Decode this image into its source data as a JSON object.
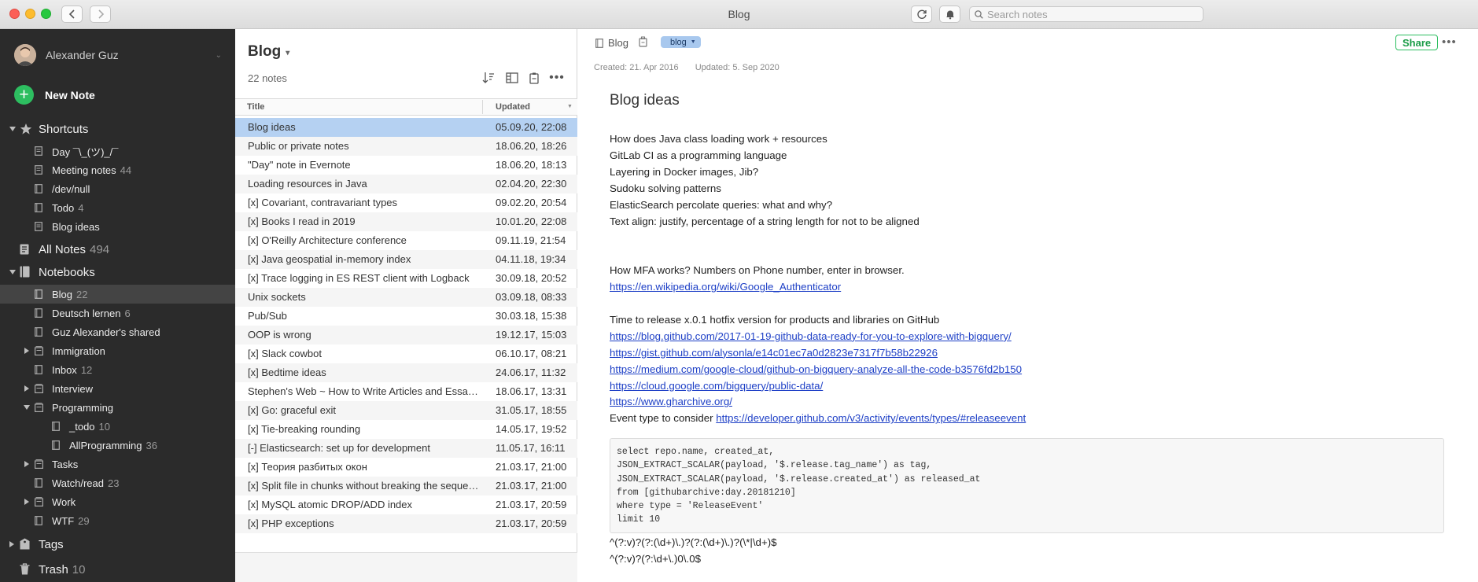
{
  "window": {
    "title": "Blog"
  },
  "toolbar": {
    "search_placeholder": "Search notes"
  },
  "sidebar": {
    "user_name": "Alexander Guz",
    "new_note_label": "New Note",
    "shortcuts_label": "Shortcuts",
    "shortcuts": [
      {
        "label": "Day ¯\\_(ツ)_/¯",
        "count": ""
      },
      {
        "label": "Meeting notes",
        "count": "44"
      },
      {
        "label": "/dev/null",
        "count": ""
      },
      {
        "label": "Todo",
        "count": "4"
      },
      {
        "label": "Blog ideas",
        "count": ""
      }
    ],
    "all_notes_label": "All Notes",
    "all_notes_count": "494",
    "notebooks_label": "Notebooks",
    "notebooks": [
      {
        "label": "Blog",
        "count": "22"
      },
      {
        "label": "Deutsch lernen",
        "count": "6"
      },
      {
        "label": "Guz Alexander's shared",
        "count": ""
      },
      {
        "label": "Immigration",
        "count": ""
      },
      {
        "label": "Inbox",
        "count": "12"
      },
      {
        "label": "Interview",
        "count": ""
      },
      {
        "label": "Programming",
        "count": ""
      },
      {
        "label": "_todo",
        "count": "10"
      },
      {
        "label": "AllProgramming",
        "count": "36"
      },
      {
        "label": "Tasks",
        "count": ""
      },
      {
        "label": "Watch/read",
        "count": "23"
      },
      {
        "label": "Work",
        "count": ""
      },
      {
        "label": "WTF",
        "count": "29"
      }
    ],
    "tags_label": "Tags",
    "trash_label": "Trash",
    "trash_count": "10"
  },
  "notelist": {
    "title": "Blog",
    "count_label": "22 notes",
    "col_title": "Title",
    "col_updated": "Updated",
    "rows": [
      {
        "title": "Blog ideas",
        "date": "05.09.20, 22:08"
      },
      {
        "title": "Public or private notes",
        "date": "18.06.20, 18:26"
      },
      {
        "title": "\"Day\" note in Evernote",
        "date": "18.06.20, 18:13"
      },
      {
        "title": "Loading resources in Java",
        "date": "02.04.20, 22:30"
      },
      {
        "title": "[x] Covariant, contravariant types",
        "date": "09.02.20, 20:54"
      },
      {
        "title": "[x] Books I read in 2019",
        "date": "10.01.20, 22:08"
      },
      {
        "title": "[x] O'Reilly Architecture conference",
        "date": "09.11.19, 21:54"
      },
      {
        "title": "[x] Java geospatial in-memory index",
        "date": "04.11.18, 19:34"
      },
      {
        "title": "[x] Trace logging in ES REST client with Logback",
        "date": "30.09.18, 20:52"
      },
      {
        "title": "Unix sockets",
        "date": "03.09.18, 08:33"
      },
      {
        "title": "Pub/Sub",
        "date": "30.03.18, 15:38"
      },
      {
        "title": "OOP is wrong",
        "date": "19.12.17, 15:03"
      },
      {
        "title": "[x] Slack cowbot",
        "date": "06.10.17, 08:21"
      },
      {
        "title": "[x] Bedtime ideas",
        "date": "24.06.17, 11:32"
      },
      {
        "title": "Stephen's Web ~ How to Write Articles and Essays Quickly and Expertly",
        "date": "18.06.17, 13:31"
      },
      {
        "title": "[x] Go: graceful exit",
        "date": "31.05.17, 18:55"
      },
      {
        "title": "[x] Tie-breaking rounding",
        "date": "14.05.17, 19:52"
      },
      {
        "title": "[-] Elasticsearch: set up for development",
        "date": "11.05.17, 16:11"
      },
      {
        "title": "[x] Теория разбитых окон",
        "date": "21.03.17, 21:00"
      },
      {
        "title": "[x] Split file in chunks without breaking the sequence",
        "date": "21.03.17, 21:00"
      },
      {
        "title": "[x] MySQL atomic DROP/ADD index",
        "date": "21.03.17, 20:59"
      },
      {
        "title": "[x] PHP exceptions",
        "date": "21.03.17, 20:59"
      }
    ]
  },
  "editor": {
    "notebook": "Blog",
    "tag": "blog",
    "share_label": "Share",
    "created": "Created: 21. Apr 2016",
    "updated": "Updated: 5. Sep 2020",
    "title": "Blog ideas",
    "lines1": [
      "How does Java class loading work + resources",
      "GitLab CI as a programming language",
      "Layering in Docker images, Jib?",
      "Sudoku solving patterns",
      "ElasticSearch percolate queries: what and why?",
      "Text align: justify, percentage of a string length for not to be aligned"
    ],
    "mfa_text": "How MFA works? Numbers on Phone number, enter in browser.",
    "mfa_link": "https://en.wikipedia.org/wiki/Google_Authenticator",
    "release_text": "Time to release x.0.1 hotfix version for products and libraries on GitHub",
    "links": [
      "https://blog.github.com/2017-01-19-github-data-ready-for-you-to-explore-with-bigquery/",
      "https://gist.github.com/alysonla/e14c01ec7a0d2823e7317f7b58b22926",
      "https://medium.com/google-cloud/github-on-bigquery-analyze-all-the-code-b3576fd2b150",
      "https://cloud.google.com/bigquery/public-data/",
      "https://www.gharchive.org/"
    ],
    "event_prefix": "Event type to consider ",
    "event_link": "https://developer.github.com/v3/activity/events/types/#releaseevent",
    "code": [
      "select repo.name, created_at,",
      "JSON_EXTRACT_SCALAR(payload, '$.release.tag_name') as tag,",
      "JSON_EXTRACT_SCALAR(payload, '$.release.created_at') as released_at",
      "from [githubarchive:day.20181210]",
      "where type = 'ReleaseEvent'",
      "limit 10"
    ],
    "regex1": "^(?:v)?(?:(\\d+)\\.)?(?:(\\d+)\\.)?(\\*|\\d+)$",
    "regex2": "^(?:v)?(?:\\d+\\.)0\\.0$"
  },
  "colors": {
    "accent_green": "#2dbe60",
    "sidebar_bg": "#2b2b2b",
    "selection_blue": "#b5d1f2",
    "tag_blue": "#a8c8ee",
    "link_blue": "#1d3fc6"
  },
  "icons": {
    "back": "chevron-left-icon",
    "forward": "chevron-right-icon",
    "sync": "sync-icon",
    "notifications": "bell-icon",
    "search": "search-icon",
    "sort": "sort-icon",
    "view": "view-options-icon",
    "reminder": "reminder-icon",
    "more": "more-icon",
    "shortcuts": "star-icon",
    "note": "note-icon",
    "notebook": "notebook-icon",
    "stack": "notebook-stack-icon",
    "tags": "tag-icon",
    "trash": "trash-icon",
    "lock": "lock-icon"
  }
}
